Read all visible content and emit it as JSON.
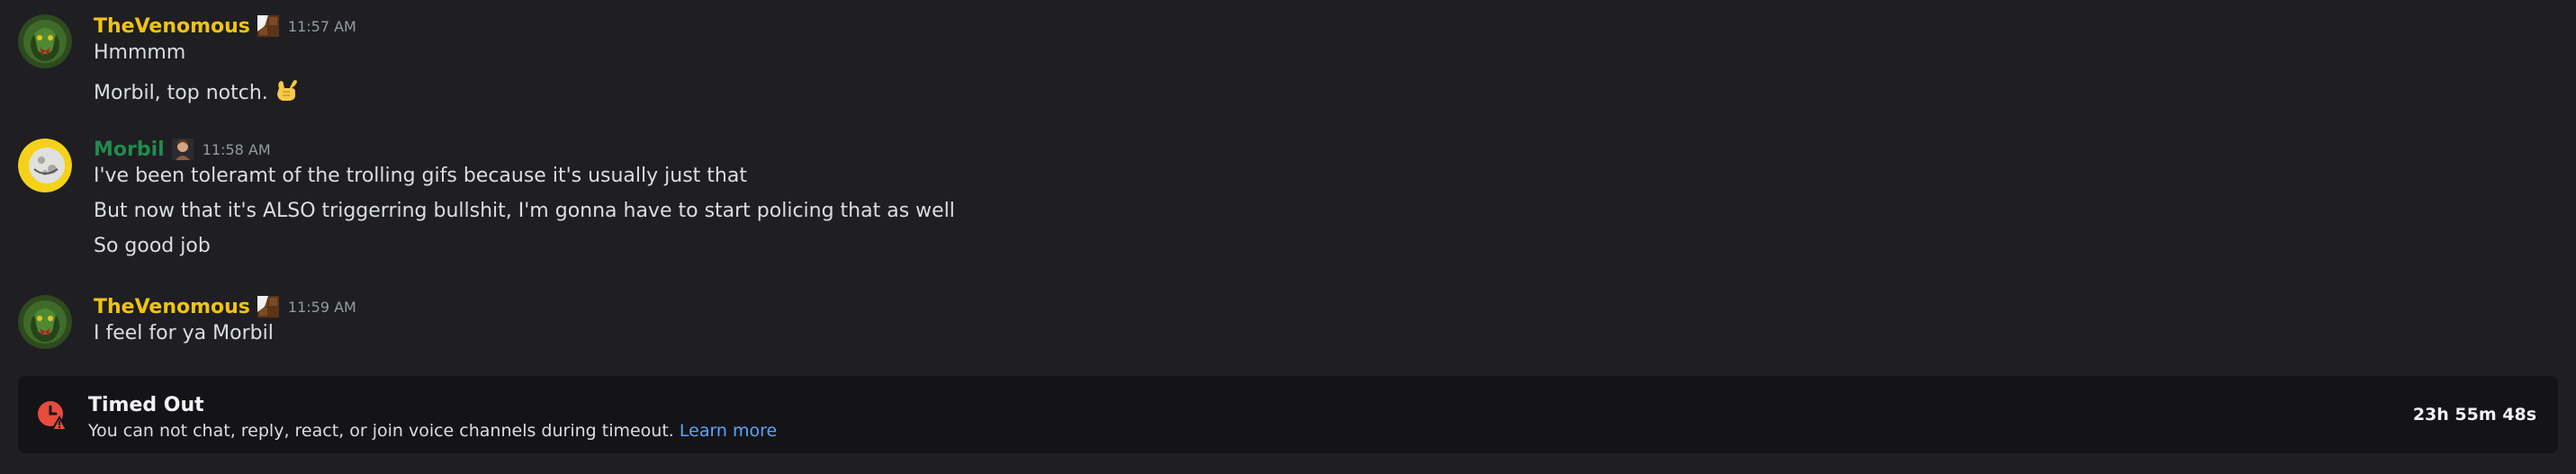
{
  "colors": {
    "background": "#1e1e23",
    "venomous_name": "#f1c40f",
    "morbil_name": "#1f8b4c",
    "timestamp": "#949ba4",
    "link": "#5ca3ff",
    "timeout_icon": "#e74c3c"
  },
  "messages": [
    {
      "username": "TheVenomous",
      "timestamp": "11:57 AM",
      "avatar_icon": "snake-avatar-icon",
      "role_icon": "chocolate-bar-icon",
      "lines": [
        "Hmmmm",
        "Morbil, top notch."
      ],
      "emoji": "🤙"
    },
    {
      "username": "Morbil",
      "timestamp": "11:58 AM",
      "avatar_icon": "moon-face-avatar-icon",
      "role_icon": "portrait-role-icon",
      "lines": [
        "I've been toleramt of the trolling gifs because it's usually just that",
        "But now that it's ALSO triggerring bullshit, I'm gonna have to start policing that as well",
        "So good job"
      ]
    },
    {
      "username": "TheVenomous",
      "timestamp": "11:59 AM",
      "avatar_icon": "snake-avatar-icon",
      "role_icon": "chocolate-bar-icon",
      "lines": [
        "I feel for ya Morbil"
      ]
    }
  ],
  "timeout": {
    "title": "Timed Out",
    "description": "You can not chat, reply, react, or join voice channels during timeout.",
    "link_text": "Learn more",
    "remaining": "23h 55m 48s",
    "icon": "clock-warning-icon"
  }
}
